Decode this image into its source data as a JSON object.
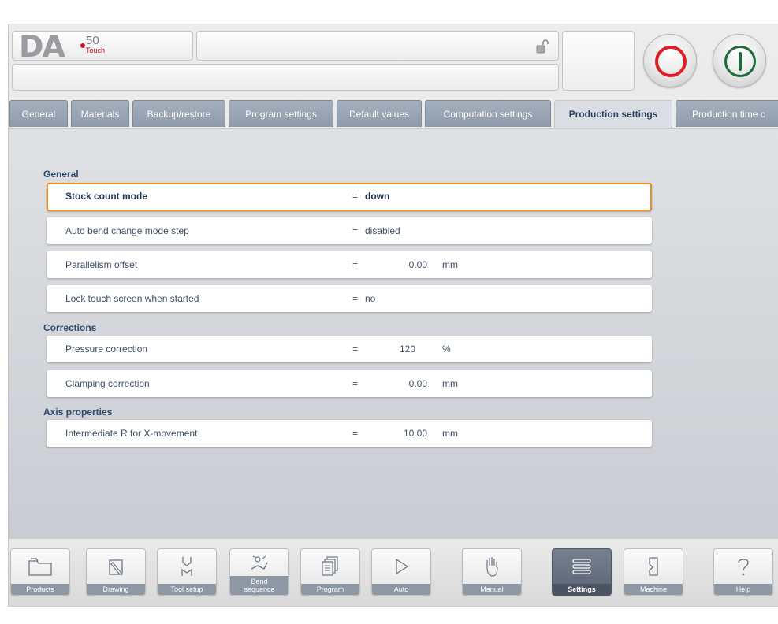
{
  "header": {
    "logo_text": "DA",
    "logo_model": "50",
    "logo_sub": "Touch",
    "title": "",
    "status_text": ""
  },
  "tabs": [
    {
      "label": "General",
      "active": false
    },
    {
      "label": "Materials",
      "active": false
    },
    {
      "label": "Backup/restore",
      "active": false
    },
    {
      "label": "Program settings",
      "active": false
    },
    {
      "label": "Default values",
      "active": false
    },
    {
      "label": "Computation settings",
      "active": false
    },
    {
      "label": "Production settings",
      "active": true
    },
    {
      "label": "Production time c",
      "active": false
    }
  ],
  "sections": {
    "general": {
      "title": "General",
      "rows": [
        {
          "label": "Stock count mode",
          "eq": "=",
          "value": "down",
          "unit": ""
        },
        {
          "label": "Auto bend change mode step",
          "eq": "=",
          "value": "disabled",
          "unit": ""
        },
        {
          "label": "Parallelism offset",
          "eq": "=",
          "value": "0.00",
          "unit": "mm"
        },
        {
          "label": "Lock touch screen when started",
          "eq": "=",
          "value": "no",
          "unit": ""
        }
      ]
    },
    "corrections": {
      "title": "Corrections",
      "rows": [
        {
          "label": "Pressure correction",
          "eq": "=",
          "value": "120",
          "unit": "%"
        },
        {
          "label": "Clamping correction",
          "eq": "=",
          "value": "0.00",
          "unit": "mm"
        }
      ]
    },
    "axis": {
      "title": "Axis properties",
      "rows": [
        {
          "label": "Intermediate R for X-movement",
          "eq": "=",
          "value": "10.00",
          "unit": "mm"
        }
      ]
    }
  },
  "toolbar": {
    "products": "Products",
    "drawing": "Drawing",
    "tool_setup": "Tool setup",
    "bend_sequence_1": "Bend",
    "bend_sequence_2": "sequence",
    "program": "Program",
    "auto": "Auto",
    "manual": "Manual",
    "settings": "Settings",
    "machine": "Machine",
    "help": "Help",
    "active": "Settings"
  },
  "icons": {
    "products": "folder-icon",
    "drawing": "pencil-icon",
    "tool_setup": "tool-icon",
    "bend_sequence": "bend-sequence-icon",
    "program": "pages-icon",
    "auto": "play-icon",
    "manual": "hand-icon",
    "settings": "list-icon",
    "machine": "machine-icon",
    "help": "question-icon",
    "lock": "unlock-icon"
  },
  "colors": {
    "accent_selected": "#e9901c",
    "stop_ring": "#e01e25",
    "start_ring": "#1f6b3a",
    "tab_inactive": "#95a0b0",
    "section_title": "#2c4a6e"
  }
}
